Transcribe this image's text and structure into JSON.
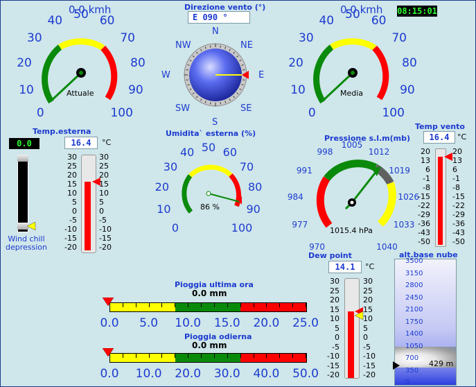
{
  "wind_avg_speed": {
    "value": "0.0 kmh",
    "label": "Attuale",
    "ticks": [
      "0",
      "10",
      "20",
      "30",
      "40",
      "50",
      "60",
      "70",
      "80",
      "90",
      "100"
    ]
  },
  "wind_gust_speed": {
    "value": "0.0 kmh",
    "label": "Media",
    "ticks": [
      "0",
      "10",
      "20",
      "30",
      "40",
      "50",
      "60",
      "70",
      "80",
      "90",
      "100"
    ]
  },
  "clock": {
    "time": "08:15:01"
  },
  "wind_direction": {
    "title": "Direzione vento (°)",
    "value": "E  090 °",
    "compass": [
      "N",
      "NE",
      "E",
      "SE",
      "S",
      "SW",
      "W",
      "NW"
    ]
  },
  "temp_outside": {
    "title": "Temp.esterna",
    "value": "16.4",
    "unit": "°C",
    "level": 16.4,
    "scale": [
      "30",
      "25",
      "20",
      "15",
      "10",
      "5",
      "0",
      "-5",
      "-10",
      "-15",
      "-20"
    ],
    "windchill_value": "0.0",
    "windchill_label": "Wind chill depression"
  },
  "humidity": {
    "title": "Umidita` esterna (%)",
    "value": "86 %",
    "ticks": [
      "0",
      "10",
      "20",
      "30",
      "40",
      "50",
      "60",
      "70",
      "80",
      "90",
      "100"
    ]
  },
  "pressure": {
    "title": "Pressione s.l.m(mb)",
    "value": "1015.4 hPa",
    "ticks": [
      "970",
      "977",
      "984",
      "991",
      "998",
      "1005",
      "1012",
      "1019",
      "1026",
      "1033",
      "1040"
    ]
  },
  "temp_wind": {
    "title": "Temp vento",
    "value": "16.4",
    "unit": "°C",
    "level": 16.4,
    "scale": [
      "20",
      "13",
      "6",
      "-1",
      "-8",
      "-15",
      "-22",
      "-29",
      "-36",
      "-43",
      "-50"
    ]
  },
  "dew_point": {
    "title": "Dew point",
    "value": "14.1",
    "unit": "°C",
    "level": 14.1,
    "scale": [
      "30",
      "25",
      "20",
      "15",
      "10",
      "5",
      "0",
      "-5",
      "-10",
      "-15",
      "-20"
    ]
  },
  "cloud_base": {
    "title": "alt.base nube",
    "value": "429 m",
    "level": 429,
    "scale": [
      "3500",
      "3150",
      "2800",
      "2450",
      "2100",
      "1750",
      "1400",
      "1050",
      "700",
      "350",
      "0"
    ]
  },
  "rain_hour": {
    "title": "Pioggia ultima ora",
    "value": "0.0 mm",
    "ticks": [
      "0.0",
      "5.0",
      "10.0",
      "15.0",
      "20.0",
      "25.0"
    ]
  },
  "rain_day": {
    "title": "Pioggia odierna",
    "value": "0.0 mm",
    "ticks": [
      "0.0",
      "10.0",
      "20.0",
      "30.0",
      "40.0",
      "50.0"
    ]
  },
  "colors": {
    "green": "#0a8a0a",
    "yellow": "#ffff00",
    "red": "#ff0000",
    "blue": "#1c3bd0"
  }
}
